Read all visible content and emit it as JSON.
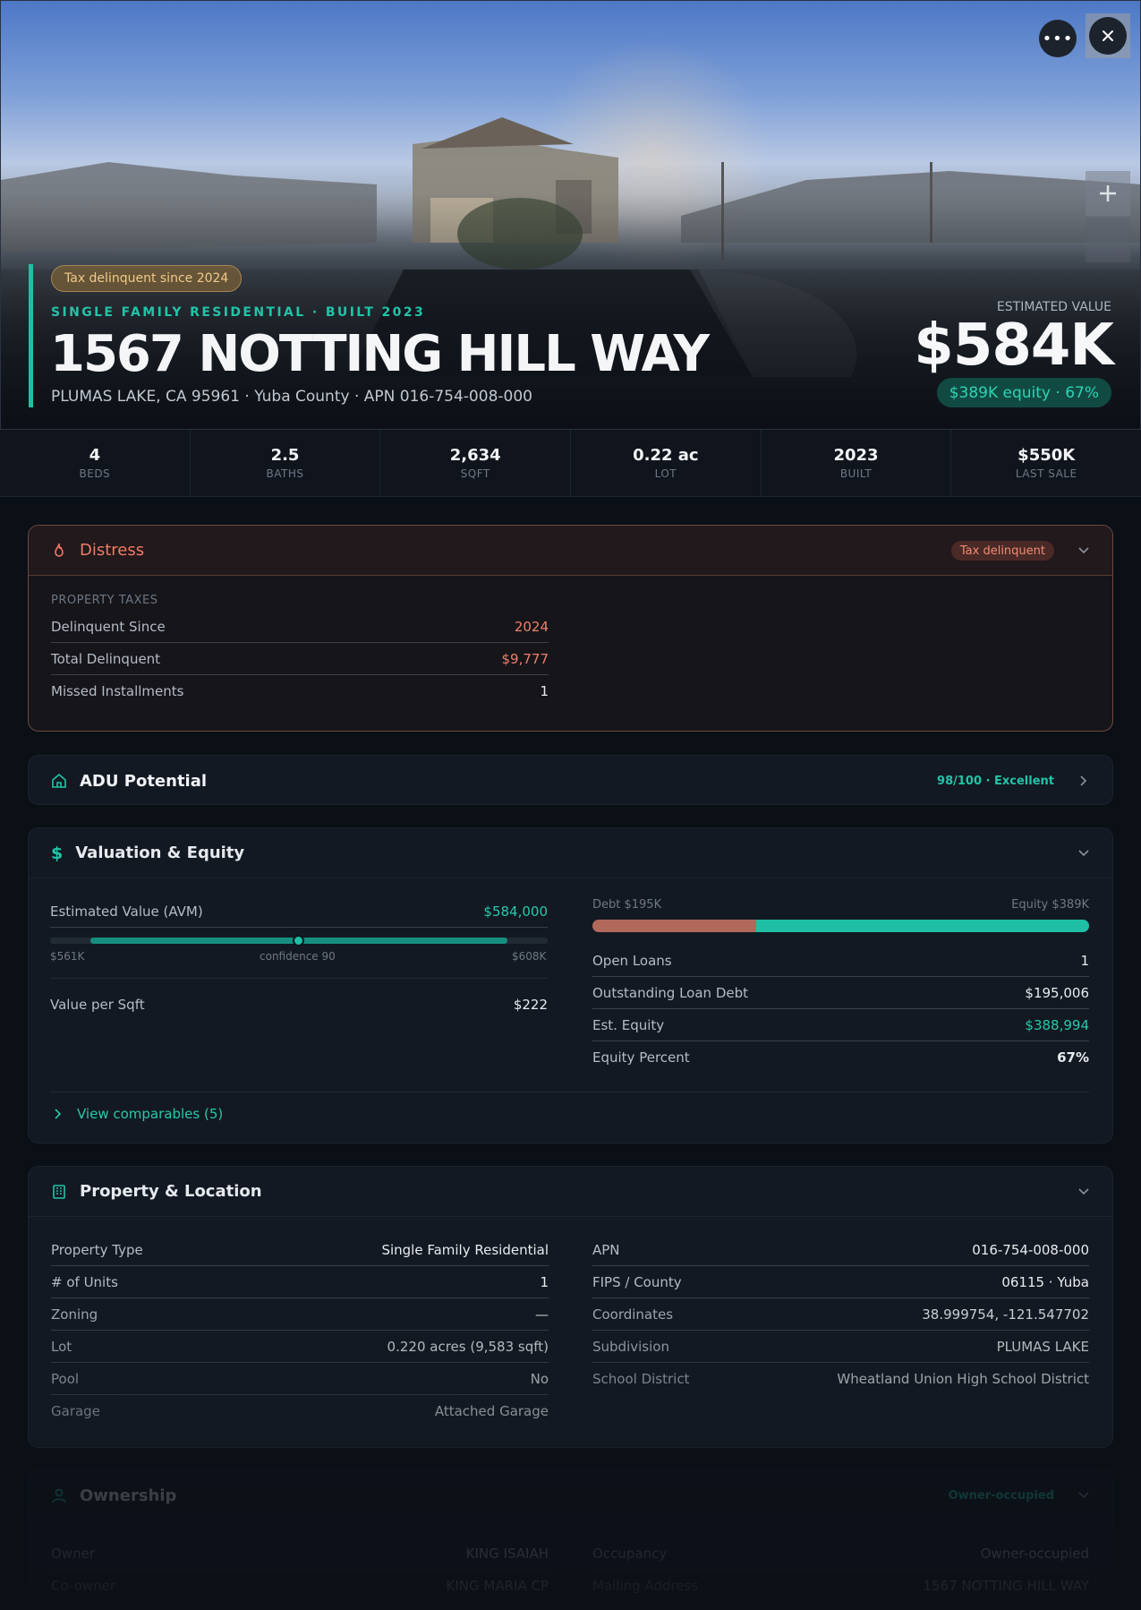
{
  "hero": {
    "tax_pill": "Tax delinquent since 2024",
    "property_type_line": "SINGLE FAMILY RESIDENTIAL · BUILT 2023",
    "address": "1567 NOTTING HILL WAY",
    "location_line": "PLUMAS LAKE, CA 95961 · Yuba County · APN 016-754-008-000",
    "estimated_value_label": "ESTIMATED VALUE",
    "estimated_value": "$584K",
    "equity_pill": "$389K equity · 67%"
  },
  "stats": [
    {
      "value": "4",
      "label": "BEDS"
    },
    {
      "value": "2.5",
      "label": "BATHS"
    },
    {
      "value": "2,634",
      "label": "SQFT"
    },
    {
      "value": "0.22 ac",
      "label": "LOT"
    },
    {
      "value": "2023",
      "label": "BUILT"
    },
    {
      "value": "$550K",
      "label": "LAST SALE"
    }
  ],
  "distress": {
    "title": "Distress",
    "tag": "Tax delinquent",
    "section_label": "PROPERTY TAXES",
    "rows": [
      {
        "k": "Delinquent Since",
        "v": "2024"
      },
      {
        "k": "Total Delinquent",
        "v": "$9,777"
      },
      {
        "k": "Missed Installments",
        "v": "1"
      }
    ]
  },
  "adu": {
    "title": "ADU Potential",
    "score": "98/100 · Excellent"
  },
  "valuation": {
    "title": "Valuation & Equity",
    "avm_label": "Estimated Value (AVM)",
    "avm_value": "$584,000",
    "range_low": "$561K",
    "confidence": "confidence 90",
    "range_high": "$608K",
    "value_per_sqft_label": "Value per Sqft",
    "value_per_sqft": "$222",
    "debt_label": "Debt $195K",
    "equity_label": "Equity $389K",
    "debt_fraction": 0.33,
    "rows": [
      {
        "k": "Open Loans",
        "v": "1"
      },
      {
        "k": "Outstanding Loan Debt",
        "v": "$195,006"
      },
      {
        "k": "Est. Equity",
        "v": "$388,994"
      },
      {
        "k": "Equity Percent",
        "v": "67%"
      }
    ],
    "view_comparables": "View comparables (5)"
  },
  "property": {
    "title": "Property & Location",
    "left": [
      {
        "k": "Property Type",
        "v": "Single Family Residential"
      },
      {
        "k": "# of Units",
        "v": "1"
      },
      {
        "k": "Zoning",
        "v": "—"
      },
      {
        "k": "Lot",
        "v": "0.220 acres (9,583 sqft)"
      },
      {
        "k": "Pool",
        "v": "No"
      },
      {
        "k": "Garage",
        "v": "Attached Garage"
      }
    ],
    "right": [
      {
        "k": "APN",
        "v": "016-754-008-000"
      },
      {
        "k": "FIPS / County",
        "v": "06115 · Yuba"
      },
      {
        "k": "Coordinates",
        "v": "38.999754, -121.547702"
      },
      {
        "k": "Subdivision",
        "v": "PLUMAS LAKE"
      },
      {
        "k": "School District",
        "v": "Wheatland Union High School District"
      }
    ]
  },
  "ownership": {
    "title": "Ownership",
    "tag": "Owner-occupied",
    "left": [
      {
        "k": "Owner",
        "v": "KING ISAIAH"
      },
      {
        "k": "Co-owner",
        "v": "KING MARIA CP"
      }
    ],
    "right": [
      {
        "k": "Occupancy",
        "v": "Owner-occupied"
      },
      {
        "k": "Mailing Address",
        "v": "1567 NOTTING HILL WAY"
      }
    ]
  },
  "colors": {
    "accent": "#1fbfa6",
    "distress": "#f07a66",
    "background": "#0b0f16"
  }
}
